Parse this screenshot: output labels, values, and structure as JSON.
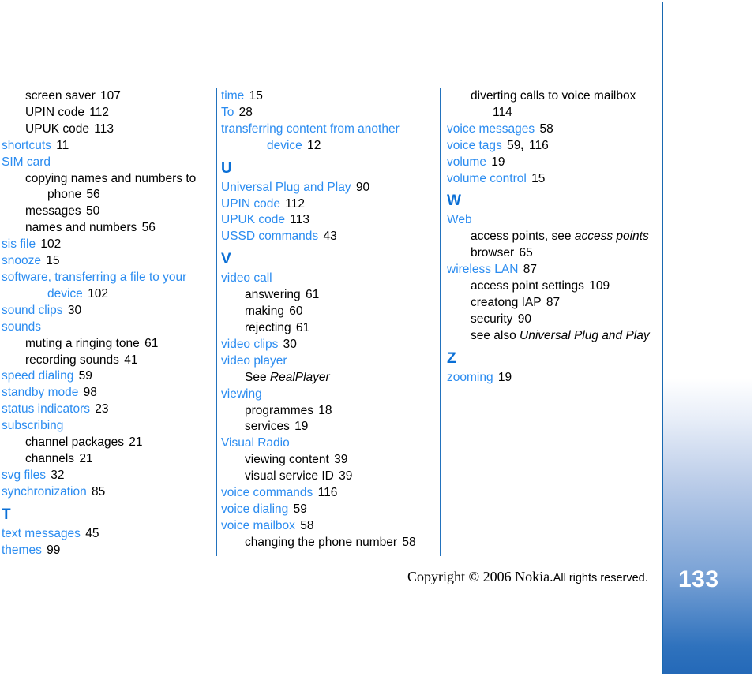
{
  "document": {
    "page_number": "133",
    "footer": {
      "copyright_main": "Copyright © 2006 Nokia.",
      "copyright_rights": "All rights reserved."
    }
  },
  "index": {
    "columns": [
      {
        "id": "column-1",
        "entries": [
          {
            "kind": "subentry",
            "label": "screen saver",
            "page": "107"
          },
          {
            "kind": "subentry",
            "label": "UPIN code",
            "page": "112"
          },
          {
            "kind": "subentry",
            "label": "UPUK code",
            "page": "113"
          },
          {
            "kind": "entry",
            "label": "shortcuts",
            "page": "11"
          },
          {
            "kind": "entry",
            "label": "SIM card",
            "page": ""
          },
          {
            "kind": "subentry",
            "label": "copying names and numbers to phone",
            "page": "56"
          },
          {
            "kind": "subentry",
            "label": "messages",
            "page": "50"
          },
          {
            "kind": "subentry",
            "label": "names and numbers",
            "page": "56"
          },
          {
            "kind": "entry",
            "label": "sis file",
            "page": "102"
          },
          {
            "kind": "entry",
            "label": "snooze",
            "page": "15"
          },
          {
            "kind": "entry",
            "label": "software, transferring a file to your device",
            "page": "102"
          },
          {
            "kind": "entry",
            "label": "sound clips",
            "page": "30"
          },
          {
            "kind": "entry",
            "label": "sounds",
            "page": ""
          },
          {
            "kind": "subentry",
            "label": "muting a ringing tone",
            "page": "61"
          },
          {
            "kind": "subentry",
            "label": "recording sounds",
            "page": "41"
          },
          {
            "kind": "entry",
            "label": "speed dialing",
            "page": "59"
          },
          {
            "kind": "entry",
            "label": "standby mode",
            "page": "98"
          },
          {
            "kind": "entry",
            "label": "status indicators",
            "page": "23"
          },
          {
            "kind": "entry",
            "label": "subscribing",
            "page": ""
          },
          {
            "kind": "subentry",
            "label": "channel packages",
            "page": "21"
          },
          {
            "kind": "subentry",
            "label": "channels",
            "page": "21"
          },
          {
            "kind": "entry",
            "label": "svg files",
            "page": "32"
          },
          {
            "kind": "entry",
            "label": "synchronization",
            "page": "85"
          },
          {
            "kind": "letter",
            "label": "T"
          },
          {
            "kind": "entry",
            "label": "text messages",
            "page": "45"
          },
          {
            "kind": "entry",
            "label": "themes",
            "page": "99"
          }
        ]
      },
      {
        "id": "column-2",
        "entries": [
          {
            "kind": "entry",
            "label": "time",
            "page": "15"
          },
          {
            "kind": "entry",
            "label": "To",
            "page": "28"
          },
          {
            "kind": "entry",
            "label": "transferring content from another device",
            "page": "12"
          },
          {
            "kind": "letter",
            "label": "U"
          },
          {
            "kind": "entry",
            "label": "Universal Plug and Play",
            "page": "90"
          },
          {
            "kind": "entry",
            "label": "UPIN code",
            "page": "112"
          },
          {
            "kind": "entry",
            "label": "UPUK code",
            "page": "113"
          },
          {
            "kind": "entry",
            "label": "USSD commands",
            "page": "43"
          },
          {
            "kind": "letter",
            "label": "V"
          },
          {
            "kind": "entry",
            "label": "video call",
            "page": ""
          },
          {
            "kind": "subentry",
            "label": "answering",
            "page": "61"
          },
          {
            "kind": "subentry",
            "label": "making",
            "page": "60"
          },
          {
            "kind": "subentry",
            "label": "rejecting",
            "page": "61"
          },
          {
            "kind": "entry",
            "label": "video clips",
            "page": "30"
          },
          {
            "kind": "entry",
            "label": "video player",
            "page": ""
          },
          {
            "kind": "subentry",
            "label": "See ",
            "italic_tail": "RealPlayer",
            "page": ""
          },
          {
            "kind": "entry",
            "label": "viewing",
            "page": ""
          },
          {
            "kind": "subentry",
            "label": "programmes",
            "page": "18"
          },
          {
            "kind": "subentry",
            "label": "services",
            "page": "19"
          },
          {
            "kind": "entry",
            "label": "Visual Radio",
            "page": ""
          },
          {
            "kind": "subentry",
            "label": "viewing content",
            "page": "39"
          },
          {
            "kind": "subentry",
            "label": "visual service ID",
            "page": "39"
          },
          {
            "kind": "entry",
            "label": "voice commands",
            "page": "116"
          },
          {
            "kind": "entry",
            "label": "voice dialing",
            "page": "59"
          },
          {
            "kind": "entry",
            "label": "voice mailbox",
            "page": "58"
          },
          {
            "kind": "subentry",
            "label": "changing the phone number",
            "page": "58"
          }
        ]
      },
      {
        "id": "column-3",
        "entries": [
          {
            "kind": "subentry",
            "label": "diverting calls to voice mailbox",
            "page": "114"
          },
          {
            "kind": "entry",
            "label": "voice messages",
            "page": "58"
          },
          {
            "kind": "entry",
            "label": "voice tags",
            "page": "59",
            "page2": "116",
            "separator": ","
          },
          {
            "kind": "entry",
            "label": "volume",
            "page": "19"
          },
          {
            "kind": "entry",
            "label": "volume control",
            "page": "15"
          },
          {
            "kind": "letter",
            "label": "W"
          },
          {
            "kind": "entry",
            "label": "Web",
            "page": ""
          },
          {
            "kind": "subentry",
            "label": "access points, see ",
            "italic_tail": "access points",
            "page": ""
          },
          {
            "kind": "subentry",
            "label": "browser",
            "page": "65"
          },
          {
            "kind": "entry",
            "label": "wireless LAN",
            "page": "87"
          },
          {
            "kind": "subentry",
            "label": "access point settings",
            "page": "109"
          },
          {
            "kind": "subentry",
            "label": "creatong IAP",
            "page": "87"
          },
          {
            "kind": "subentry",
            "label": "security",
            "page": "90"
          },
          {
            "kind": "subentry",
            "label": "see also ",
            "italic_tail": "Universal Plug and Play",
            "page": ""
          },
          {
            "kind": "letter",
            "label": "Z"
          },
          {
            "kind": "entry",
            "label": "zooming",
            "page": "19"
          }
        ]
      }
    ]
  },
  "colors": {
    "entry_link": "#2b8cf0",
    "letter_heading": "#0a6fd6",
    "divider": "#2272bd",
    "edge_bar_bottom": "#2469b8",
    "edge_bar_border": "#1868b0"
  }
}
